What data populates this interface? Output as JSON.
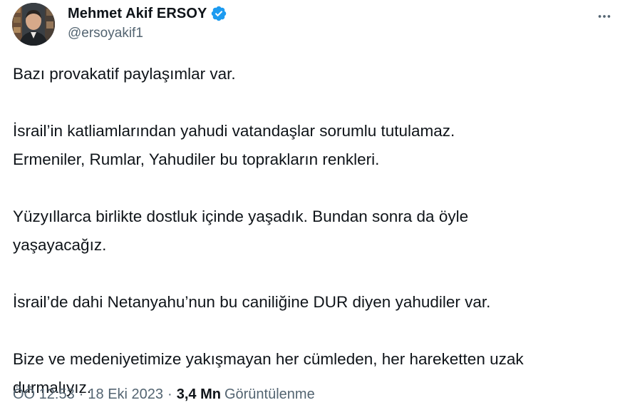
{
  "author": {
    "name": "Mehmet Akif ERSOY",
    "handle": "@ersoyakif1",
    "verified_color": "#1d9bf0"
  },
  "tweet": {
    "paragraphs": [
      [
        "Bazı provakatif paylaşımlar var."
      ],
      [
        "İsrail’in katliamlarından yahudi vatandaşlar sorumlu tutulamaz.",
        "Ermeniler, Rumlar, Yahudiler bu toprakların renkleri."
      ],
      [
        "Yüzyıllarca birlikte dostluk içinde yaşadık. Bundan sonra da öyle",
        "yaşayacağız."
      ],
      [
        "İsrail’de dahi Netanyahu’nun bu caniliğine DUR diyen yahudiler var."
      ],
      [
        "Bize ve medeniyetimize yakışmayan her cümleden, her hareketten uzak",
        "durmalıyız."
      ]
    ]
  },
  "meta": {
    "time": "ÖÖ 12:53",
    "separator": "·",
    "date": "18 Eki 2023",
    "views_count": "3,4 Mn",
    "views_label": "Görüntülenme"
  },
  "icons": {
    "verified": "verified-badge-icon",
    "more": "more-options-icon"
  }
}
